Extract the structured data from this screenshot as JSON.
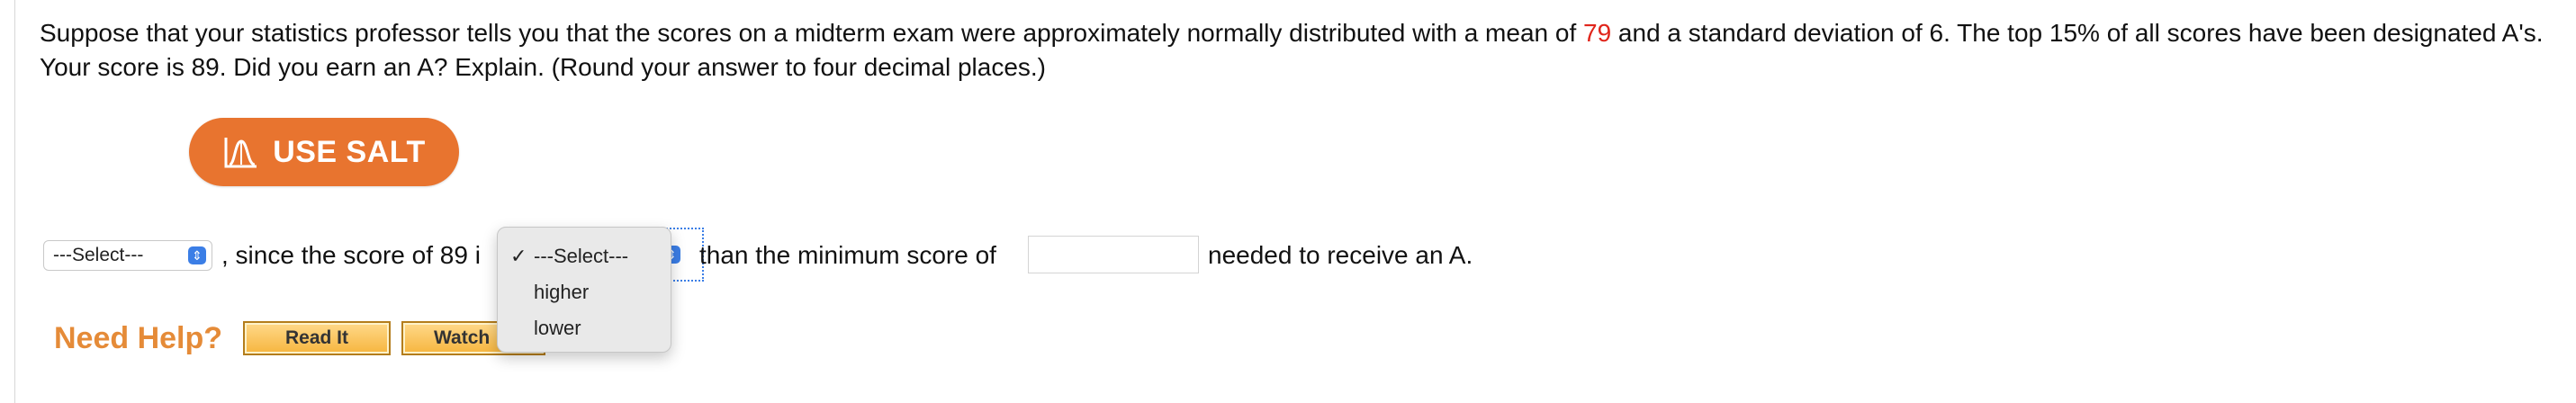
{
  "question": {
    "part1": "Suppose that your statistics professor tells you that the scores on a midterm exam were approximately normally distributed with a mean of ",
    "mean": "79",
    "part2": " and a standard deviation of 6. The top 15% of all scores have been designated A's. Your score is 89. Did you earn an A? Explain. (Round your answer to four decimal places.)"
  },
  "salt_button": {
    "label": "USE SALT",
    "icon": "salt-chart-icon"
  },
  "answer": {
    "select1_value": "---Select---",
    "text_since": ", since the score of 89 i",
    "text_than": "than the minimum score of",
    "min_score_value": "",
    "text_needed": "needed to receive an A."
  },
  "dropdown": {
    "items": [
      {
        "label": "---Select---",
        "checked": true
      },
      {
        "label": "higher",
        "checked": false
      },
      {
        "label": "lower",
        "checked": false
      }
    ],
    "check_mark": "✓"
  },
  "help": {
    "title": "Need Help?",
    "read_it": "Read It",
    "watch_it": "Watch"
  },
  "colors": {
    "accent_orange": "#e8742f",
    "help_orange": "#e58b38",
    "mean_red": "#e0251b",
    "select_blue": "#3b7ee6"
  }
}
